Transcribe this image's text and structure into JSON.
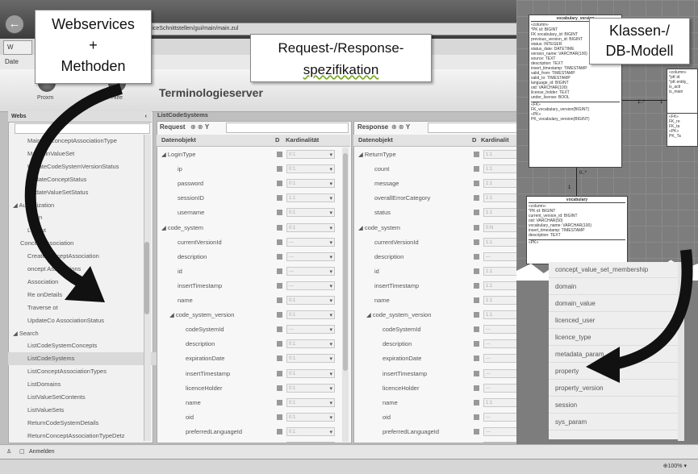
{
  "window": {
    "url": "...viceSchnittstellen/gui/main/main.zul",
    "tab_label": "W",
    "menu_label": "Date"
  },
  "toolbar": {
    "left_button_label": "Proxm",
    "help_button_label": "Hilfe",
    "app_title": "Terminologieserver"
  },
  "left_panel": {
    "header": "Webs",
    "items": [
      {
        "label": "MaintainConceptAssociationType",
        "indent": 2
      },
      {
        "label": "MaintainValueSet",
        "indent": 2
      },
      {
        "label": "UpdateCodeSystemVersionStatus",
        "indent": 2
      },
      {
        "label": "UpdateConceptStatus",
        "indent": 2
      },
      {
        "label": "UpdateValueSetStatus",
        "indent": 2
      },
      {
        "label": "◢ Authorization",
        "indent": 0
      },
      {
        "label": "Login",
        "indent": 2
      },
      {
        "label": "Logout",
        "indent": 2
      },
      {
        "label": "ConceptAssociation",
        "indent": 1
      },
      {
        "label": "CreateConceptAssociation",
        "indent": 2
      },
      {
        "label": "oncept Associations",
        "indent": 2
      },
      {
        "label": "Association",
        "indent": 2
      },
      {
        "label": "Re onDetails",
        "indent": 2
      },
      {
        "label": "Traverse ot",
        "indent": 2
      },
      {
        "label": "UpdateCo AssociationStatus",
        "indent": 2
      },
      {
        "label": "◢ Search",
        "indent": 0
      },
      {
        "label": "ListCodeSystemConcepts",
        "indent": 2
      },
      {
        "label": "ListCodeSystems",
        "indent": 2,
        "selected": true
      },
      {
        "label": "ListConceptAssociationTypes",
        "indent": 2
      },
      {
        "label": "ListDomains",
        "indent": 2
      },
      {
        "label": "ListValueSetContents",
        "indent": 2
      },
      {
        "label": "ListValueSets",
        "indent": 2
      },
      {
        "label": "ReturnCodeSystemDetails",
        "indent": 2
      },
      {
        "label": "ReturnConceptAssociationTypeDetz",
        "indent": 2
      }
    ]
  },
  "request": {
    "section_title": "ListCodeSystems",
    "title": "Request",
    "columns": [
      "Datenobjekt",
      "D",
      "Kardinalität"
    ],
    "rows": [
      {
        "label": "◢ LoginType",
        "indent": 0,
        "card": "0:1"
      },
      {
        "label": "ip",
        "indent": 2,
        "card": "0:1"
      },
      {
        "label": "password",
        "indent": 2,
        "card": "0:1"
      },
      {
        "label": "sessionID",
        "indent": 2,
        "card": "1:1"
      },
      {
        "label": "username",
        "indent": 2,
        "card": "0:1"
      },
      {
        "label": "◢ code_system",
        "indent": 0,
        "card": "0:1"
      },
      {
        "label": "currentVersionId",
        "indent": 2,
        "card": "---"
      },
      {
        "label": "description",
        "indent": 2,
        "card": "---"
      },
      {
        "label": "id",
        "indent": 2,
        "card": "---"
      },
      {
        "label": "insertTimestamp",
        "indent": 2,
        "card": "---"
      },
      {
        "label": "name",
        "indent": 2,
        "card": "0:1"
      },
      {
        "label": "◢ code_system_version",
        "indent": 1,
        "card": "0:1"
      },
      {
        "label": "codeSystemId",
        "indent": 3,
        "card": "---"
      },
      {
        "label": "description",
        "indent": 3,
        "card": "0:1"
      },
      {
        "label": "expirationDate",
        "indent": 3,
        "card": "0:1"
      },
      {
        "label": "insertTimestamp",
        "indent": 3,
        "card": "0:1"
      },
      {
        "label": "licenceHolder",
        "indent": 3,
        "card": "0:1"
      },
      {
        "label": "name",
        "indent": 3,
        "card": "0:1"
      },
      {
        "label": "oid",
        "indent": 3,
        "card": "0:1"
      },
      {
        "label": "preferredLanguageId",
        "indent": 3,
        "card": "0:1"
      },
      {
        "label": "previousVersionID",
        "indent": 3,
        "card": "0:1"
      }
    ]
  },
  "response": {
    "title": "Response",
    "columns": [
      "Datenobjekt",
      "D",
      "Kardinalit"
    ],
    "rows": [
      {
        "label": "◢ ReturnType",
        "indent": 0,
        "card": "1:1"
      },
      {
        "label": "count",
        "indent": 2,
        "card": "1:1"
      },
      {
        "label": "message",
        "indent": 2,
        "card": "1:1"
      },
      {
        "label": "overallErrorCategory",
        "indent": 2,
        "card": "1:1"
      },
      {
        "label": "status",
        "indent": 2,
        "card": "1:1"
      },
      {
        "label": "◢ code_system",
        "indent": 0,
        "card": "0:N"
      },
      {
        "label": "currentVersionId",
        "indent": 2,
        "card": "1:1"
      },
      {
        "label": "description",
        "indent": 2,
        "card": "---"
      },
      {
        "label": "id",
        "indent": 2,
        "card": "1:1"
      },
      {
        "label": "insertTimestamp",
        "indent": 2,
        "card": "1:1"
      },
      {
        "label": "name",
        "indent": 2,
        "card": "1:1"
      },
      {
        "label": "◢ code_system_version",
        "indent": 1,
        "card": "1:1"
      },
      {
        "label": "codeSystemId",
        "indent": 3,
        "card": "---"
      },
      {
        "label": "description",
        "indent": 3,
        "card": "---"
      },
      {
        "label": "expirationDate",
        "indent": 3,
        "card": "---"
      },
      {
        "label": "insertTimestamp",
        "indent": 3,
        "card": "---"
      },
      {
        "label": "licenceHolder",
        "indent": 3,
        "card": "---"
      },
      {
        "label": "name",
        "indent": 3,
        "card": "1:1"
      },
      {
        "label": "oid",
        "indent": 3,
        "card": "---"
      },
      {
        "label": "preferredLanguageId",
        "indent": 3,
        "card": "---"
      },
      {
        "label": "previousVersionID",
        "indent": 3,
        "card": "---"
      }
    ]
  },
  "uml": {
    "box1_title": "vocabulary_version",
    "box1_lines": [
      "«column»",
      "*PK id: BIGINT",
      "FK vocabulary_id: BIGINT",
      "previous_version_id: BIGINT",
      "status: INTEGER",
      "status_date: DATETIME",
      "version_name: VARCHAR(100)",
      "source: TEXT",
      "description: TEXT",
      "insert_timestamp: TIMESTAMP",
      "valid_from: TIMESTAMP",
      "valid_to: TIMESTAMP",
      "language_id: BIGINT",
      "oid: VARCHAR(100)",
      "license_holder: TEXT",
      "under_license: BOOL"
    ],
    "box1_ops": [
      "«FK»",
      "FK_vocabulary_version(BIGINT)",
      "«PK»",
      "PK_vocabulary_version(BIGINT)"
    ],
    "box2_title": "vocabulary",
    "box2_lines": [
      "«column»",
      "*PK id: BIGINT",
      "current_version_id: BIGINT",
      "oid: VARCHAR(50)",
      "vocabulary_name: VARCHAR(100)",
      "insert_timestamp: TIMESTAMP",
      "description: TEXT"
    ],
    "box2_ops": [
      "«PK»"
    ],
    "box3_lines": [
      "«column»",
      "*pK id",
      "*pK entity_",
      "is_acti",
      "is_main"
    ],
    "box3_ops": [
      "«FK»",
      "FK_re",
      "FK_ta",
      "«PK»",
      "PK_Ta"
    ],
    "mult_1": "1",
    "mult_2": "0..*",
    "mult_3": "1..*",
    "mult_4": "1"
  },
  "classes": {
    "items": [
      "concept_value_set_membership",
      "domain",
      "domain_value",
      "licenced_user",
      "licence_type",
      "metadata_param",
      "property",
      "property_version",
      "session",
      "sys_param"
    ]
  },
  "status": {
    "login_label": "Anmelden",
    "zoom": "100%"
  },
  "annotations": {
    "webservices_line1": "Webservices",
    "webservices_line2": "+",
    "webservices_line3": "Methoden",
    "request_line1": "Request-/Response-",
    "request_line2": "spezifikation",
    "klassen_line1": "Klassen-/",
    "klassen_line2": "DB-Modell"
  }
}
